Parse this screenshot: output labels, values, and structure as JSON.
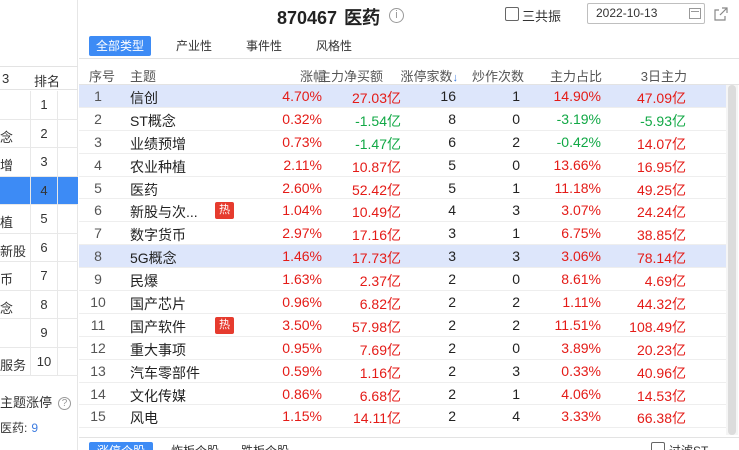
{
  "header": {
    "code": "870467",
    "name": "医药",
    "checkbox_label": "三共振",
    "date": "2022-10-13"
  },
  "tabs": [
    "全部类型",
    "产业性",
    "事件性",
    "风格性"
  ],
  "columns": [
    "序号",
    "主题",
    "涨幅",
    "主力净买额",
    "涨停家数",
    "炒作次数",
    "主力占比",
    "3日主力"
  ],
  "sort_arrow": "↓",
  "rows": [
    {
      "idx": "1",
      "name": "信创",
      "hot": "",
      "chg": "4.70%",
      "flow": "27.03亿",
      "cnt": "16",
      "spec": "1",
      "ratio": "14.90%",
      "d3": "47.09亿",
      "chg_c": "red",
      "flow_c": "red",
      "ratio_c": "red",
      "d3_c": "red"
    },
    {
      "idx": "2",
      "name": "ST概念",
      "hot": "",
      "chg": "0.32%",
      "flow": "-1.54亿",
      "cnt": "8",
      "spec": "0",
      "ratio": "-3.19%",
      "d3": "-5.93亿",
      "chg_c": "red",
      "flow_c": "green",
      "ratio_c": "green",
      "d3_c": "green"
    },
    {
      "idx": "3",
      "name": "业绩预增",
      "hot": "",
      "chg": "0.73%",
      "flow": "-1.47亿",
      "cnt": "6",
      "spec": "2",
      "ratio": "-0.42%",
      "d3": "14.07亿",
      "chg_c": "red",
      "flow_c": "green",
      "ratio_c": "green",
      "d3_c": "red"
    },
    {
      "idx": "4",
      "name": "农业种植",
      "hot": "",
      "chg": "2.11%",
      "flow": "10.87亿",
      "cnt": "5",
      "spec": "0",
      "ratio": "13.66%",
      "d3": "16.95亿",
      "chg_c": "red",
      "flow_c": "red",
      "ratio_c": "red",
      "d3_c": "red"
    },
    {
      "idx": "5",
      "name": "医药",
      "hot": "",
      "chg": "2.60%",
      "flow": "52.42亿",
      "cnt": "5",
      "spec": "1",
      "ratio": "11.18%",
      "d3": "49.25亿",
      "chg_c": "red",
      "flow_c": "red",
      "ratio_c": "red",
      "d3_c": "red"
    },
    {
      "idx": "6",
      "name": "新股与次...",
      "hot": "热",
      "chg": "1.04%",
      "flow": "10.49亿",
      "cnt": "4",
      "spec": "3",
      "ratio": "3.07%",
      "d3": "24.24亿",
      "chg_c": "red",
      "flow_c": "red",
      "ratio_c": "red",
      "d3_c": "red"
    },
    {
      "idx": "7",
      "name": "数字货币",
      "hot": "",
      "chg": "2.97%",
      "flow": "17.16亿",
      "cnt": "3",
      "spec": "1",
      "ratio": "6.75%",
      "d3": "38.85亿",
      "chg_c": "red",
      "flow_c": "red",
      "ratio_c": "red",
      "d3_c": "red"
    },
    {
      "idx": "8",
      "name": "5G概念",
      "hot": "",
      "chg": "1.46%",
      "flow": "17.73亿",
      "cnt": "3",
      "spec": "3",
      "ratio": "3.06%",
      "d3": "78.14亿",
      "chg_c": "red",
      "flow_c": "red",
      "ratio_c": "red",
      "d3_c": "red"
    },
    {
      "idx": "9",
      "name": "民爆",
      "hot": "",
      "chg": "1.63%",
      "flow": "2.37亿",
      "cnt": "2",
      "spec": "0",
      "ratio": "8.61%",
      "d3": "4.69亿",
      "chg_c": "red",
      "flow_c": "red",
      "ratio_c": "red",
      "d3_c": "red"
    },
    {
      "idx": "10",
      "name": "国产芯片",
      "hot": "",
      "chg": "0.96%",
      "flow": "6.82亿",
      "cnt": "2",
      "spec": "2",
      "ratio": "1.11%",
      "d3": "44.32亿",
      "chg_c": "red",
      "flow_c": "red",
      "ratio_c": "red",
      "d3_c": "red"
    },
    {
      "idx": "11",
      "name": "国产软件",
      "hot": "热",
      "chg": "3.50%",
      "flow": "57.98亿",
      "cnt": "2",
      "spec": "2",
      "ratio": "11.51%",
      "d3": "108.49亿",
      "chg_c": "red",
      "flow_c": "red",
      "ratio_c": "red",
      "d3_c": "red"
    },
    {
      "idx": "12",
      "name": "重大事项",
      "hot": "",
      "chg": "0.95%",
      "flow": "7.69亿",
      "cnt": "2",
      "spec": "0",
      "ratio": "3.89%",
      "d3": "20.23亿",
      "chg_c": "red",
      "flow_c": "red",
      "ratio_c": "red",
      "d3_c": "red"
    },
    {
      "idx": "13",
      "name": "汽车零部件",
      "hot": "",
      "chg": "0.59%",
      "flow": "1.16亿",
      "cnt": "2",
      "spec": "3",
      "ratio": "0.33%",
      "d3": "40.96亿",
      "chg_c": "red",
      "flow_c": "red",
      "ratio_c": "red",
      "d3_c": "red"
    },
    {
      "idx": "14",
      "name": "文化传媒",
      "hot": "",
      "chg": "0.86%",
      "flow": "6.68亿",
      "cnt": "2",
      "spec": "1",
      "ratio": "4.06%",
      "d3": "14.53亿",
      "chg_c": "red",
      "flow_c": "red",
      "ratio_c": "red",
      "d3_c": "red"
    },
    {
      "idx": "15",
      "name": "风电",
      "hot": "",
      "chg": "1.15%",
      "flow": "14.11亿",
      "cnt": "2",
      "spec": "4",
      "ratio": "3.33%",
      "d3": "66.38亿",
      "chg_c": "red",
      "flow_c": "red",
      "ratio_c": "red",
      "d3_c": "red"
    }
  ],
  "left_panel": {
    "header_col1": "3",
    "header_col2": "排名",
    "rows": [
      {
        "name": "",
        "rank": "1"
      },
      {
        "name": "念",
        "rank": "2"
      },
      {
        "name": "增",
        "rank": "3"
      },
      {
        "name": "",
        "rank": "4"
      },
      {
        "name": "植",
        "rank": "5"
      },
      {
        "name": "新股",
        "rank": "6"
      },
      {
        "name": "币",
        "rank": "7"
      },
      {
        "name": "念",
        "rank": "8"
      },
      {
        "name": "",
        "rank": "9"
      },
      {
        "name": "服务",
        "rank": "10"
      }
    ],
    "footer_title": "主题涨停",
    "footer_label": "医药:",
    "footer_value": "9"
  },
  "bottom_tabs": [
    "涨停个股",
    "炸板个股",
    "跌板个股"
  ],
  "bottom_checkbox_label": "过滤ST"
}
